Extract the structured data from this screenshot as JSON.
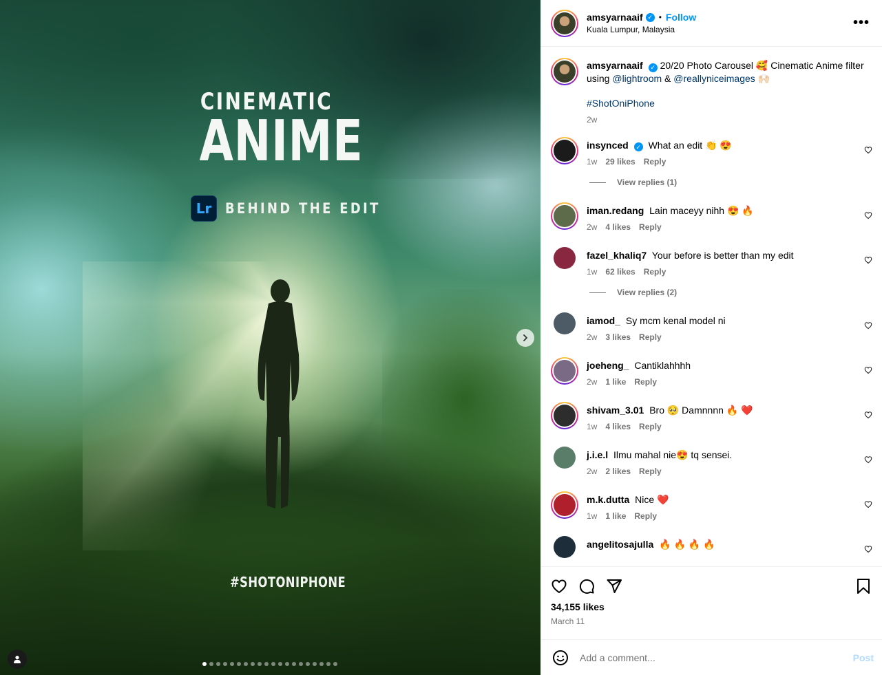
{
  "media": {
    "title_small": "CINEMATIC",
    "title_big": "ANIME",
    "lr_badge": "Lr",
    "lr_text": "BEHIND THE EDIT",
    "hashtag_overlay": "#SHOTONIPHONE",
    "next_icon": "chevron-right-icon",
    "user_tag_icon": "person-icon",
    "carousel_total": 20,
    "carousel_active": 1
  },
  "header": {
    "username": "amsyarnaaif",
    "verified": true,
    "bullet": "•",
    "follow_label": "Follow",
    "location": "Kuala Lumpur, Malaysia",
    "more_label": "•••"
  },
  "caption": {
    "username": "amsyarnaaif",
    "text_1": "20/20 Photo Carousel 🥰 Cinematic Anime filter using",
    "mention_1": "@lightroom",
    "amp": "&",
    "mention_2": "@reallyniceimages",
    "emoji_end": "🙌🏻",
    "hashtag": "#ShotOniPhone",
    "time": "2w"
  },
  "comments": [
    {
      "username": "insynced",
      "verified": true,
      "text": "What an edit 👏 😍",
      "time": "1w",
      "likes": "29 likes",
      "reply": "Reply",
      "view_replies": "View replies (1)",
      "avatar": "#1b1b1b"
    },
    {
      "username": "iman.redang",
      "verified": false,
      "text": "Lain maceyy nihh 😍 🔥",
      "time": "2w",
      "likes": "4 likes",
      "reply": "Reply",
      "view_replies": "",
      "avatar": "#5d6b4a"
    },
    {
      "username": "fazel_khaliq7",
      "verified": false,
      "text": "Your before is better than my edit",
      "time": "1w",
      "likes": "62 likes",
      "reply": "Reply",
      "view_replies": "View replies (2)",
      "avatar": "#8a2740"
    },
    {
      "username": "iamod_",
      "verified": false,
      "text": "Sy mcm kenal model ni",
      "time": "2w",
      "likes": "3 likes",
      "reply": "Reply",
      "view_replies": "",
      "avatar": "#4d5b66"
    },
    {
      "username": "joeheng_",
      "verified": false,
      "text": "Cantiklahhhh",
      "time": "2w",
      "likes": "1 like",
      "reply": "Reply",
      "view_replies": "",
      "avatar": "#7a6a86"
    },
    {
      "username": "shivam_3.01",
      "verified": false,
      "text": "Bro 🥺 Damnnnn 🔥 ❤️",
      "time": "1w",
      "likes": "4 likes",
      "reply": "Reply",
      "view_replies": "",
      "avatar": "#2d2d2d"
    },
    {
      "username": "j.i.e.l",
      "verified": false,
      "text": "Ilmu mahal nie😍 tq sensei.",
      "time": "2w",
      "likes": "2 likes",
      "reply": "Reply",
      "view_replies": "",
      "avatar": "#5a7d6a"
    },
    {
      "username": "m.k.dutta",
      "verified": false,
      "text": "Nice ❤️",
      "time": "1w",
      "likes": "1 like",
      "reply": "Reply",
      "view_replies": "",
      "avatar": "#b0202c"
    },
    {
      "username": "angelitosajulla",
      "verified": false,
      "text": "🔥 🔥 🔥 🔥",
      "time": "",
      "likes": "",
      "reply": "",
      "view_replies": "",
      "avatar": "#1e2d3a"
    }
  ],
  "actions": {
    "like_icon": "heart-icon",
    "comment_icon": "comment-icon",
    "share_icon": "paper-plane-icon",
    "save_icon": "bookmark-icon",
    "likes_count": "34,155 likes",
    "date": "March 11"
  },
  "add_comment": {
    "emoji_icon": "emoji-icon",
    "placeholder": "Add a comment...",
    "post_label": "Post"
  },
  "colors": {
    "accent": "#0095f6",
    "link": "#00376b",
    "muted": "#737373",
    "post_disabled": "#b3dbff"
  }
}
